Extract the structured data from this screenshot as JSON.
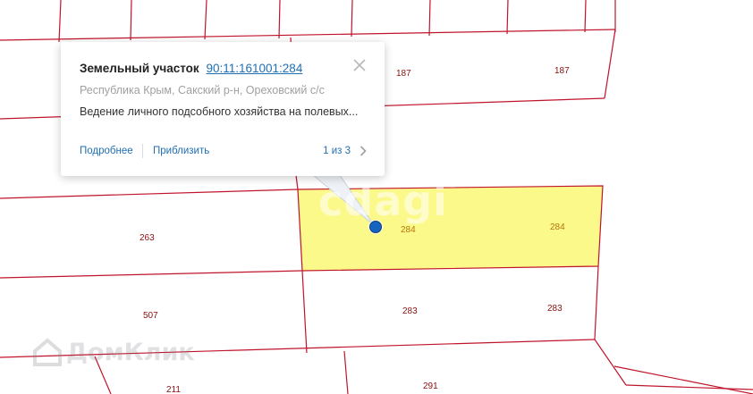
{
  "map": {
    "parcel_numbers": {
      "p187a": "187",
      "p187b": "187",
      "p263": "263",
      "p284a": "284",
      "p284b": "284",
      "p507": "507",
      "p283a": "283",
      "p283b": "283",
      "p211": "211",
      "p291": "291"
    },
    "colors": {
      "boundary": "#c0142a",
      "selected_fill": "#fbf98a",
      "marker": "#1565c0"
    }
  },
  "popup": {
    "kind": "Земельный участок",
    "cadastral_number": "90:11:161001:284",
    "address": "Республика Крым, Сакский р-н, Ореховский с/с",
    "description": "Ведение личного подсобного хозяйства на полевых...",
    "details_link": "Подробнее",
    "zoom_link": "Приблизить",
    "pager_text": "1 из 3",
    "close_icon": "close-icon",
    "next_icon": "chevron-right-icon"
  }
}
